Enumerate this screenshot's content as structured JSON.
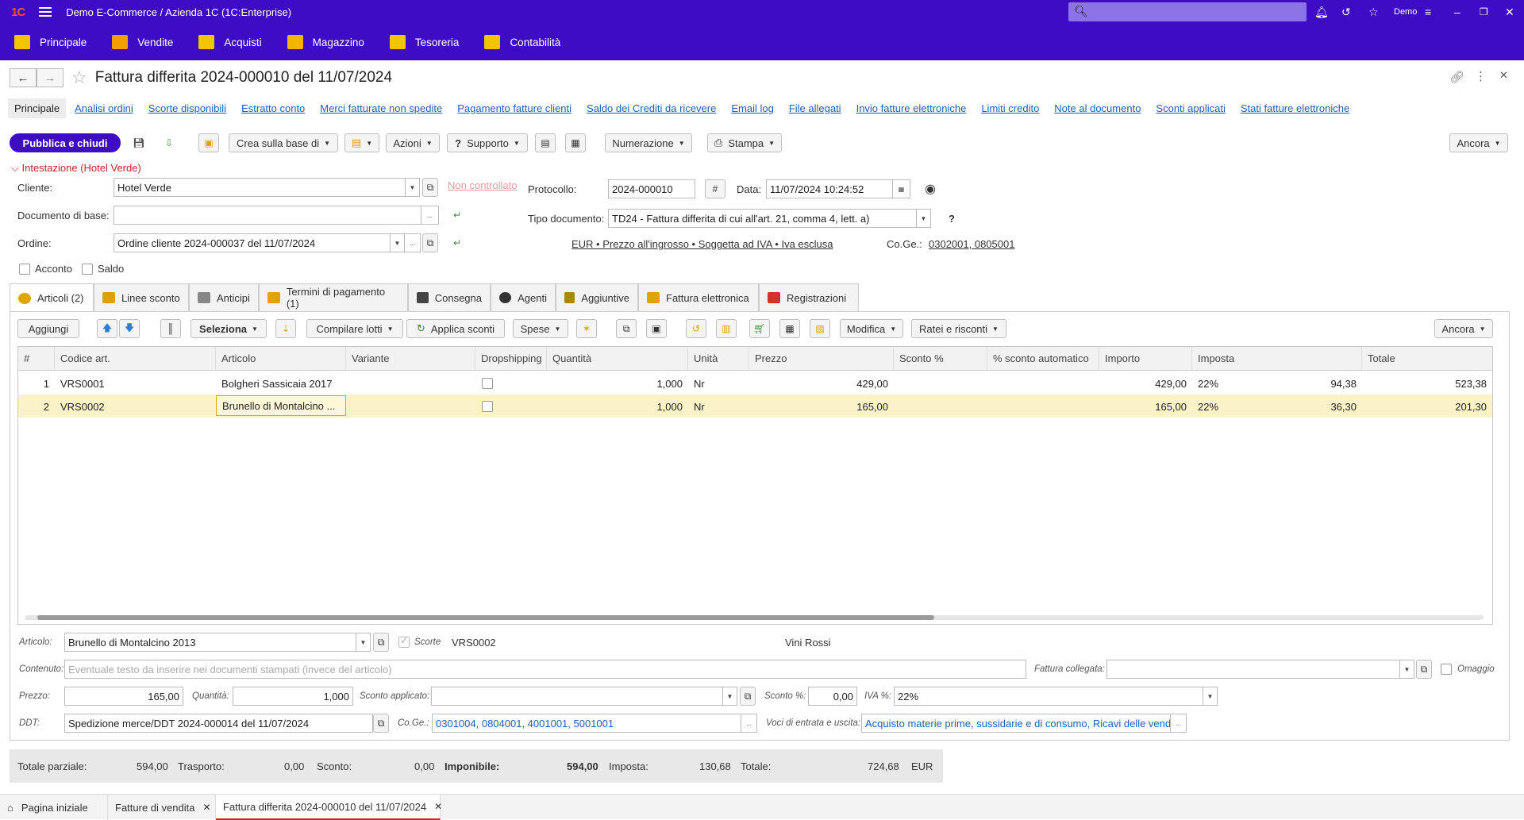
{
  "titlebar": {
    "logo": "1С",
    "title": "Demo E-Commerce / Azienda 1C  (1C:Enterprise)",
    "user": "Demo"
  },
  "sections": [
    {
      "label": "Principale",
      "icon": "home-icon",
      "color": "#f2c500"
    },
    {
      "label": "Vendite",
      "icon": "cart-icon",
      "color": "#f29f00"
    },
    {
      "label": "Acquisti",
      "icon": "truck-icon",
      "color": "#f2c500"
    },
    {
      "label": "Magazzino",
      "icon": "box-icon",
      "color": "#f2b600"
    },
    {
      "label": "Tesoreria",
      "icon": "coins-icon",
      "color": "#f2c500"
    },
    {
      "label": "Contabilità",
      "icon": "ledger-icon",
      "color": "#f2c500"
    }
  ],
  "document": {
    "title": "Fattura differita 2024-000010 del 11/07/2024"
  },
  "navlinks": [
    "Principale",
    "Analisi ordini",
    "Scorte disponibili",
    "Estratto conto",
    "Merci fatturate non spedite",
    "Pagamento fatture clienti",
    "Saldo dei Crediti  da ricevere",
    "Email log",
    "File allegati",
    "Invio fatture elettroniche",
    "Limiti credito",
    "Note al documento",
    "Sconti applicati",
    "Stati fatture elettroniche"
  ],
  "toolbar": {
    "publish": "Pubblica e chiudi",
    "create_based": "Crea sulla base di",
    "actions": "Azioni",
    "support": "Supporto",
    "numbering": "Numerazione",
    "print": "Stampa",
    "more": "Ancora"
  },
  "header": {
    "group_title": "Intestazione (Hotel Verde)",
    "cliente_label": "Cliente:",
    "cliente": "Hotel Verde",
    "non_controllato": "Non controllato",
    "documento_base_label": "Documento di base:",
    "documento_base": "",
    "ordine_label": "Ordine:",
    "ordine": "Ordine cliente 2024-000037 del 11/07/2024",
    "acconto": "Acconto",
    "saldo": "Saldo",
    "protocollo_label": "Protocollo:",
    "protocollo": "2024-000010",
    "hash": "#",
    "data_label": "Data:",
    "data": "11/07/2024 10:24:52",
    "tipo_documento_label": "Tipo documento:",
    "tipo_documento": "TD24 - Fattura differita di cui all'art. 21, comma 4, lett. a)",
    "price_link": "EUR • Prezzo all'ingrosso • Soggetta ad IVA • Iva esclusa",
    "coge_label": "Co.Ge.:",
    "coge": "0302001, 0805001"
  },
  "tabs": [
    {
      "label": "Articoli (2)",
      "color": "#e0a400"
    },
    {
      "label": "Linee sconto",
      "color": "#d9a300"
    },
    {
      "label": "Anticipi",
      "color": "#888888"
    },
    {
      "label": "Termini di pagamento (1)",
      "color": "#e0a400"
    },
    {
      "label": "Consegna",
      "color": "#444444"
    },
    {
      "label": "Agenti",
      "color": "#333333"
    },
    {
      "label": "Aggiuntive",
      "color": "#aa8800"
    },
    {
      "label": "Fattura elettronica",
      "color": "#e0a400"
    },
    {
      "label": "Registrazioni",
      "color": "#d83030"
    }
  ],
  "table_toolbar": {
    "add": "Aggiungi",
    "select": "Seleziona",
    "compile_lots": "Compilare lotti",
    "apply_discounts": "Applica sconti",
    "expenses": "Spese",
    "modify": "Modifica",
    "installments": "Ratei e risconti",
    "more": "Ancora"
  },
  "table": {
    "columns": [
      "#",
      "Codice art.",
      "Articolo",
      "Variante",
      "Dropshipping",
      "Quantità",
      "Unità",
      "Prezzo",
      "Sconto %",
      "% sconto automatico",
      "Importo",
      "Imposta",
      "",
      "Totale"
    ],
    "rows": [
      {
        "n": "1",
        "code": "VRS0001",
        "item": "Bolgheri Sassicaia 2017",
        "variant": "",
        "qty": "1,000",
        "unit": "Nr",
        "price": "429,00",
        "disc": "",
        "autodisc": "",
        "amount": "429,00",
        "tax": "22%",
        "taxamt": "94,38",
        "total": "523,38"
      },
      {
        "n": "2",
        "code": "VRS0002",
        "item": "Brunello di Montalcino ...",
        "variant": "",
        "qty": "1,000",
        "unit": "Nr",
        "price": "165,00",
        "disc": "",
        "autodisc": "",
        "amount": "165,00",
        "tax": "22%",
        "taxamt": "36,30",
        "total": "201,30"
      }
    ]
  },
  "detail": {
    "articolo_label": "Articolo:",
    "articolo": "Brunello di Montalcino 2013",
    "scorte": "Scorte",
    "code": "VRS0002",
    "producer": "Vini Rossi",
    "contenuto_label": "Contenuto:",
    "contenuto_placeholder": "Eventuale testo da inserire nei documenti stampati (invece del articolo)",
    "fattura_collegata_label": "Fattura collegata:",
    "omaggio": "Omaggio",
    "prezzo_label": "Prezzo:",
    "prezzo": "165,00",
    "quantita_label": "Quantità:",
    "quantita": "1,000",
    "sconto_applicato_label": "Sconto applicato:",
    "sconto_pct_label": "Sconto %:",
    "sconto_pct": "0,00",
    "iva_label": "IVA %:",
    "iva": "22%",
    "ddt_label": "DDT:",
    "ddt": "Spedizione merce/DDT 2024-000014 del 11/07/2024",
    "coge_label": "Co.Ge.:",
    "coge": "0301004, 0804001, 4001001, 5001001",
    "voci_label": "Voci di entrata e uscita:",
    "voci": "Acquisto materie prime, sussidarie e di consumo, Ricavi delle vendi"
  },
  "totals": {
    "parziale_label": "Totale parziale:",
    "parziale": "594,00",
    "trasporto_label": "Trasporto:",
    "trasporto": "0,00",
    "sconto_label": "Sconto:",
    "sconto": "0,00",
    "imponibile_label": "Imponibile:",
    "imponibile": "594,00",
    "imposta_label": "Imposta:",
    "imposta": "130,68",
    "totale_label": "Totale:",
    "totale": "724,68",
    "currency": "EUR"
  },
  "bottom_tabs": [
    {
      "label": "Pagina iniziale"
    },
    {
      "label": "Fatture di vendita"
    },
    {
      "label": "Fattura differita 2024-000010 del 11/07/2024"
    }
  ]
}
